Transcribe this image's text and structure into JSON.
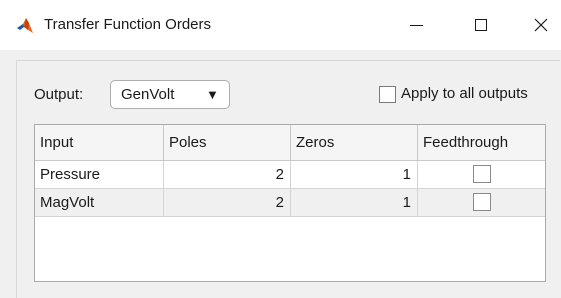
{
  "window": {
    "title": "Transfer Function Orders",
    "app_icon": "matlab-logo-icon",
    "controls": [
      "minimize-icon",
      "maximize-icon",
      "close-icon"
    ]
  },
  "output": {
    "label": "Output:",
    "selected": "GenVolt",
    "arrow": "▼"
  },
  "apply_all": {
    "label": "Apply to all outputs",
    "checked": false
  },
  "table": {
    "columns": [
      "Input",
      "Poles",
      "Zeros",
      "Feedthrough"
    ],
    "rows": [
      {
        "input": "Pressure",
        "poles": "2",
        "zeros": "1",
        "feedthrough": false
      },
      {
        "input": "MagVolt",
        "poles": "2",
        "zeros": "1",
        "feedthrough": false
      }
    ]
  },
  "colors": {
    "background": "#f0f0f0",
    "titlebar": "#ffffff",
    "logo_orange": "#e8671b",
    "logo_blue": "#1e5ea8"
  }
}
